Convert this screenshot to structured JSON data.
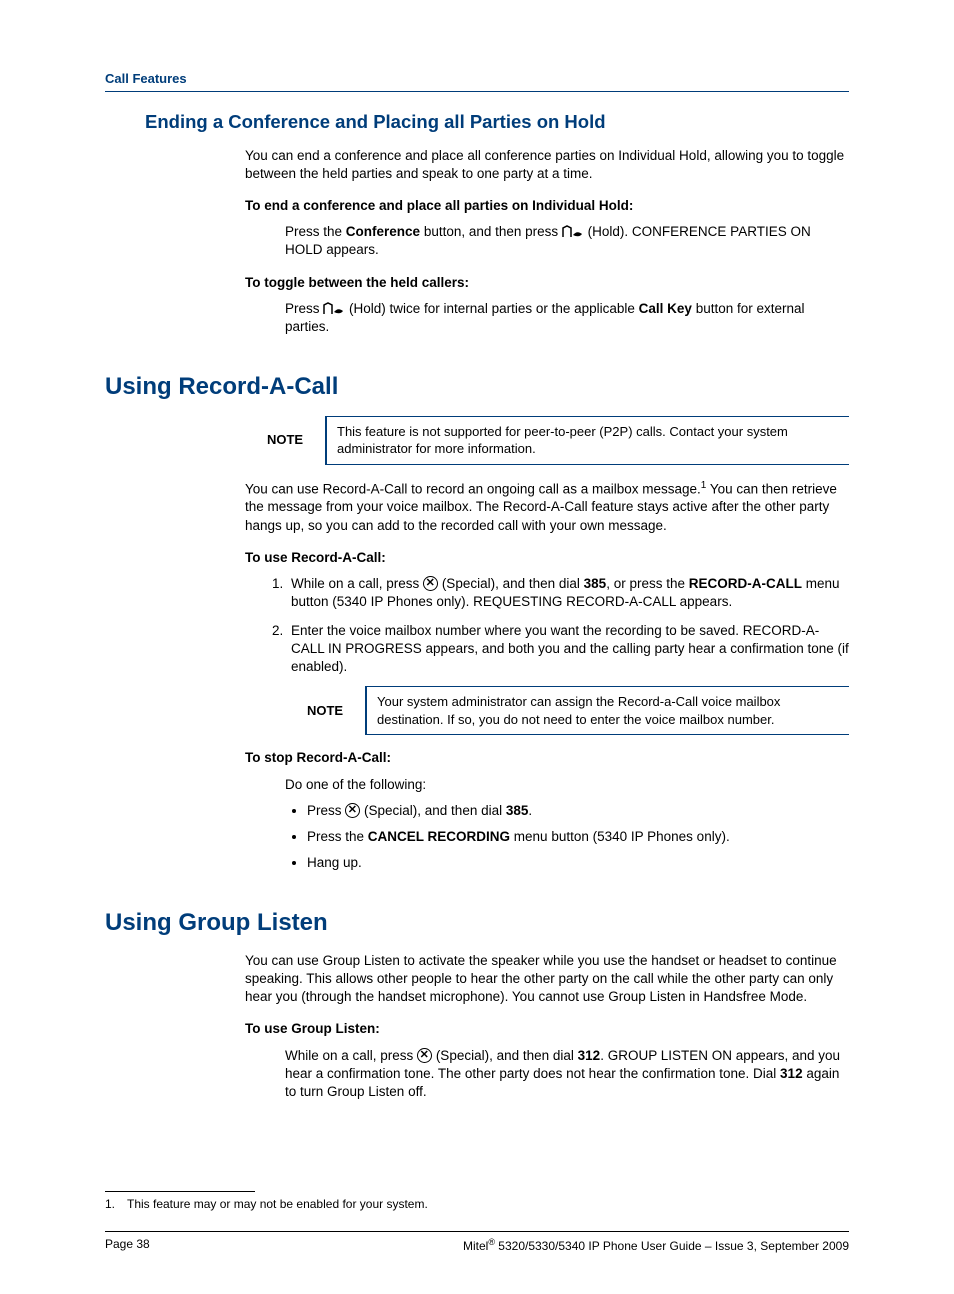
{
  "header": {
    "section": "Call Features"
  },
  "h2_1": "Ending a Conference and Placing all Parties on Hold",
  "sec1": {
    "p1": "You can end a conference and place all conference parties on Individual Hold, allowing you to toggle between the held parties and speak to one party at a time.",
    "label1": "To end a conference and place all parties on Individual Hold:",
    "inst1_a": "Press the ",
    "inst1_b": "Conference",
    "inst1_c": " button, and then press ",
    "inst1_d": " (Hold). CONFERENCE PARTIES ON HOLD appears.",
    "label2": "To toggle between the held callers:",
    "inst2_a": "Press ",
    "inst2_b": " (Hold) twice for internal parties or the applicable ",
    "inst2_c": "Call Key",
    "inst2_d": " button for external parties."
  },
  "h1_2": "Using Record-A-Call",
  "sec2": {
    "note_label": "NOTE",
    "note1": "This feature is not supported for peer-to-peer (P2P) calls. Contact your system administrator for more information.",
    "p1_a": "You can use Record-A-Call to record an ongoing call as a mailbox message.",
    "p1_b": " You can then retrieve the message from your voice mailbox. The Record-A-Call feature stays active after the other party hangs up, so you can add to the recorded call with your own message.",
    "label1": "To use Record-A-Call:",
    "li1_a": "While on a call, press ",
    "li1_b": " (Special), and then dial ",
    "li1_c": "385",
    "li1_d": ", or press the ",
    "li1_e": "RECORD-A-CALL",
    "li1_f": " menu button (5340 IP Phones only). REQUESTING RECORD-A-CALL appears.",
    "li2": "Enter the voice mailbox number where you want the recording to be saved. RECORD-A-CALL IN PROGRESS appears, and both you and the calling party hear a confirmation tone (if enabled).",
    "note2": "Your system administrator can assign the Record-a-Call voice mailbox destination. If so, you do not need to enter the voice mailbox number.",
    "label2": "To stop Record-A-Call:",
    "do_one": "Do one of the following:",
    "b1_a": "Press ",
    "b1_b": " (Special), and then dial ",
    "b1_c": "385",
    "b1_d": ".",
    "b2_a": "Press the ",
    "b2_b": "CANCEL RECORDING",
    "b2_c": " menu button (5340 IP Phones only).",
    "b3": "Hang up."
  },
  "h1_3": "Using Group Listen",
  "sec3": {
    "p1": "You can use Group Listen to activate the speaker while you use the handset or headset to continue speaking. This allows other people to hear the other party on the call while the other party can only hear you (through the handset microphone). You cannot use Group Listen in Handsfree Mode.",
    "label1": "To use Group Listen:",
    "inst_a": "While on a call, press ",
    "inst_b": " (Special), and then dial ",
    "inst_c": "312",
    "inst_d": ". GROUP LISTEN ON appears, and you hear a confirmation tone. The other party does not hear the confirmation tone. Dial ",
    "inst_e": "312",
    "inst_f": " again to turn Group Listen off."
  },
  "footnote": {
    "num": "1.",
    "text": "This feature may or may not be enabled for your system."
  },
  "footer": {
    "page": "Page 38",
    "doc_a": "Mitel",
    "doc_b": " 5320/5330/5340 IP Phone User Guide  – Issue 3, September 2009"
  }
}
